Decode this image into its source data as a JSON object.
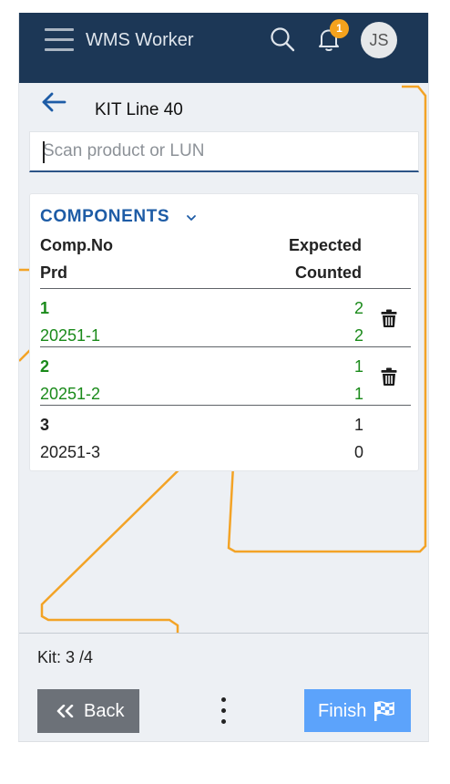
{
  "header": {
    "app_title": "WMS Worker",
    "notification_count": "1",
    "user_initials": "JS",
    "icons": [
      "menu-icon",
      "search-icon",
      "bell-icon"
    ],
    "colors": {
      "bar": "#1c3756",
      "badge": "#f4a21d"
    }
  },
  "page": {
    "title": "KIT Line 40",
    "back_icon": "arrow-left-icon"
  },
  "scan": {
    "placeholder": "Scan product or LUN",
    "value": ""
  },
  "components": {
    "section_label": "COMPONENTS",
    "columns": {
      "comp_no": "Comp.No",
      "prd": "Prd",
      "expected": "Expected",
      "counted": "Counted"
    },
    "rows": [
      {
        "comp_no": "1",
        "prd": "20251-1",
        "expected": "2",
        "counted": "2",
        "status": "complete",
        "deletable": true
      },
      {
        "comp_no": "2",
        "prd": "20251-2",
        "expected": "1",
        "counted": "1",
        "status": "complete",
        "deletable": true
      },
      {
        "comp_no": "3",
        "prd": "20251-3",
        "expected": "1",
        "counted": "0",
        "status": "pending",
        "deletable": false
      }
    ],
    "colors": {
      "complete": "#1a8a1a",
      "pending": "#222222",
      "section": "#1e5ca6"
    }
  },
  "footer": {
    "kit_progress": "Kit: 3 /4",
    "back_label": "Back",
    "finish_label": "Finish",
    "colors": {
      "back": "#6c7178",
      "finish": "#5ca3fb"
    }
  }
}
